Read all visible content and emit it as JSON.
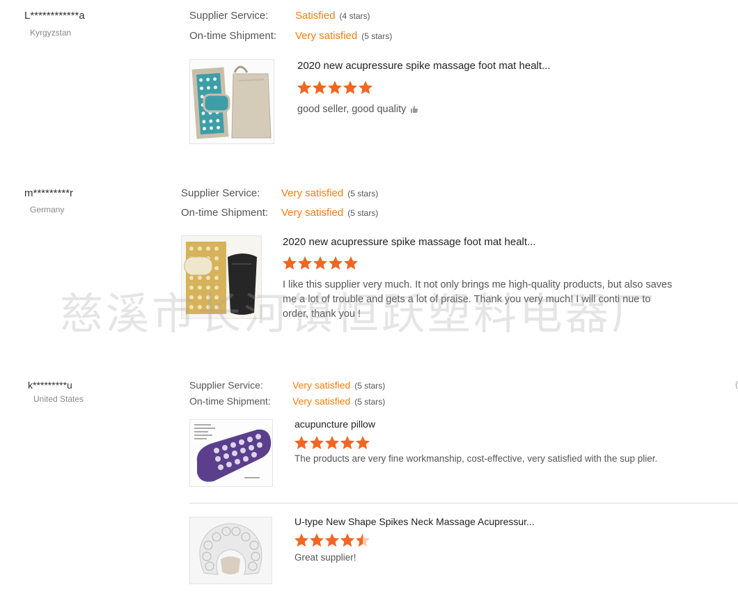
{
  "colors": {
    "accent": "#f57e0b",
    "star": "#f26522",
    "label": "#555555"
  },
  "watermark": "慈溪市长河镇恒跃塑料电器厂",
  "reviews": [
    {
      "buyer": "L************a",
      "country": "Kyrgyzstan",
      "supplier_service": {
        "label": "Supplier Service:",
        "value": "Satisfied",
        "stars": "(4 stars)"
      },
      "shipment": {
        "label": "On-time Shipment:",
        "value": "Very satisfied",
        "stars": "(5 stars)"
      },
      "products": [
        {
          "image": "acupressure-mat-with-bag-image",
          "title": "2020 new acupressure spike massage foot mat healt...",
          "rating": 5,
          "comment": "good seller, good quality"
        }
      ]
    },
    {
      "buyer": "m*********r",
      "country": "Germany",
      "supplier_service": {
        "label": "Supplier Service:",
        "value": "Very satisfied",
        "stars": "(5 stars)"
      },
      "shipment": {
        "label": "On-time Shipment:",
        "value": "Very satisfied",
        "stars": "(5 stars)"
      },
      "products": [
        {
          "image": "gold-acupressure-mat-image",
          "title": "2020 new acupressure spike massage foot mat healt...",
          "rating": 5,
          "comment": "I like this supplier very much. It not only brings me high-quality products, but also saves me a lot of trouble and gets a lot of praise. Thank you very much! I will conti nue to order, thank you !"
        }
      ]
    },
    {
      "buyer": "k*********u",
      "country": "United States",
      "supplier_service": {
        "label": "Supplier Service:",
        "value": "Very satisfied",
        "stars": "(5 stars)"
      },
      "shipment": {
        "label": "On-time Shipment:",
        "value": "Very satisfied",
        "stars": "(5 stars)"
      },
      "products": [
        {
          "image": "purple-acupuncture-pillow-image",
          "title": "acupuncture pillow",
          "rating": 5,
          "comment": "The products are very fine workmanship, cost-effective, very satisfied with the sup plier."
        },
        {
          "image": "u-shaped-neck-pillow-image",
          "title": "U-type New Shape Spikes Neck Massage Acupressur...",
          "rating": 4.5,
          "comment": "Great supplier!"
        }
      ]
    }
  ]
}
